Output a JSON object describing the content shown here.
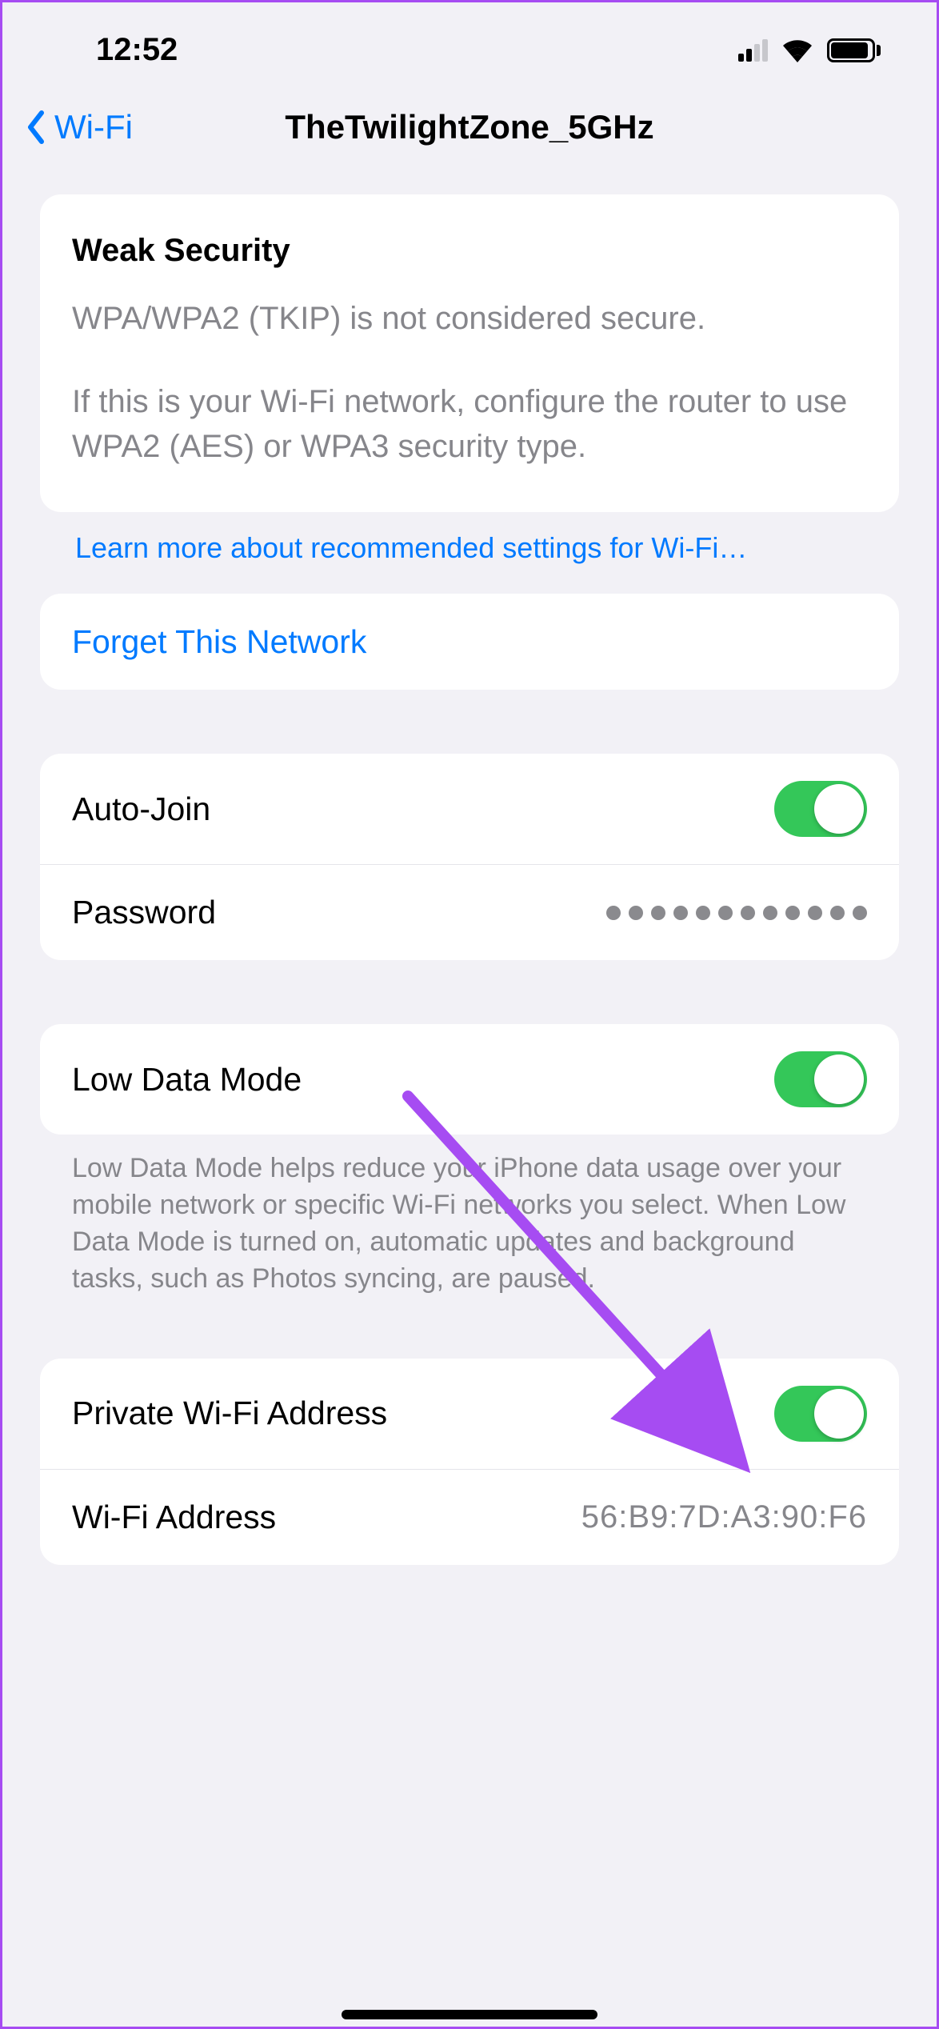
{
  "status": {
    "time": "12:52"
  },
  "nav": {
    "back_label": "Wi-Fi",
    "title": "TheTwilightZone_5GHz"
  },
  "security": {
    "title": "Weak Security",
    "body1": "WPA/WPA2 (TKIP) is not considered secure.",
    "body2": "If this is your Wi-Fi network, configure the router to use WPA2 (AES) or WPA3 security type."
  },
  "links": {
    "learn_more": "Learn more about recommended settings for Wi-Fi…",
    "forget": "Forget This Network"
  },
  "rows": {
    "auto_join": "Auto-Join",
    "password": "Password",
    "password_value": "●●●●●●●●●●●●",
    "low_data": "Low Data Mode",
    "private_wifi": "Private Wi-Fi Address",
    "wifi_address": "Wi-Fi Address",
    "wifi_address_value": "56:B9:7D:A3:90:F6"
  },
  "notes": {
    "low_data": "Low Data Mode helps reduce your iPhone data usage over your mobile network or specific Wi-Fi networks you select. When Low Data Mode is turned on, automatic updates and background tasks, such as Photos syncing, are paused."
  },
  "toggles": {
    "auto_join": true,
    "low_data": true,
    "private_wifi": true
  }
}
